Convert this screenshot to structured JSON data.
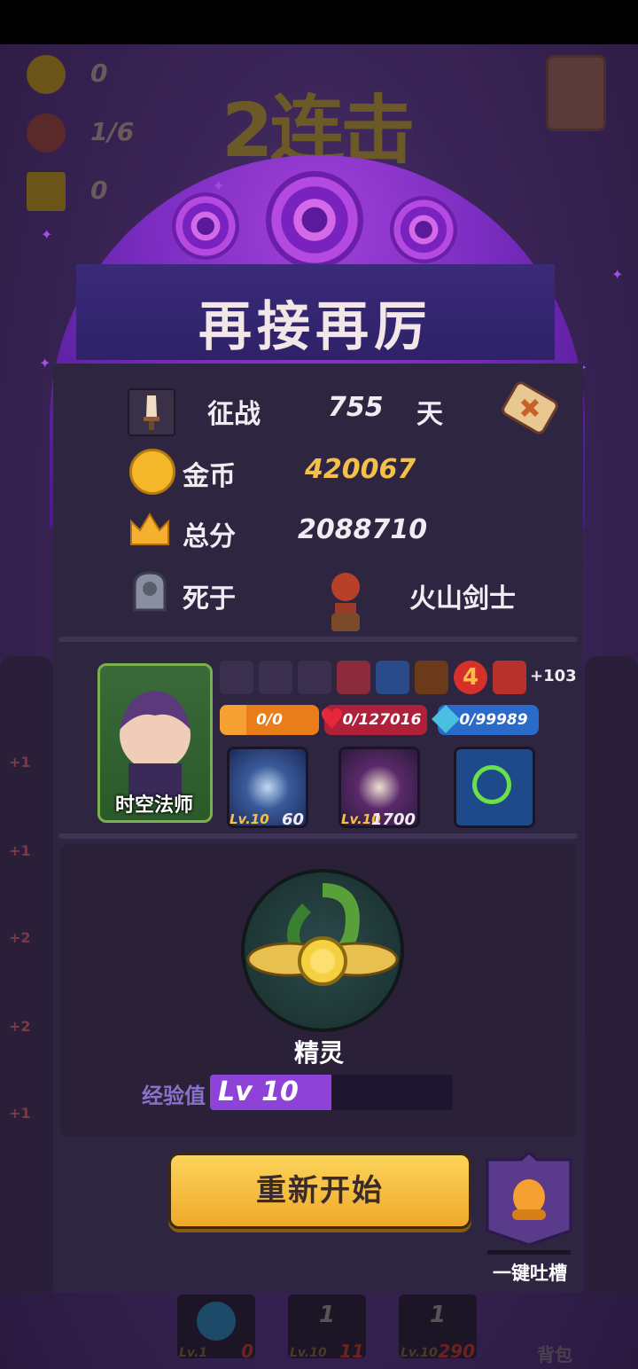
{
  "hud": {
    "coins": "0",
    "kills": "1/6",
    "crowns": "0",
    "combo": "2连击"
  },
  "result": {
    "title": "再接再厉",
    "campaign_label": "征战",
    "campaign_days": "755",
    "campaign_unit": "天",
    "gold_label": "金币",
    "gold_value": "420067",
    "score_label": "总分",
    "score_value": "2088710",
    "death_label": "死于",
    "killer_name": "火山剑士"
  },
  "hero": {
    "name": "时空法师",
    "items_more": "+103",
    "item_badge": "4",
    "shield": "0/0",
    "hp": "0/127016",
    "mana": "0/99989",
    "skills": [
      {
        "level": "Lv.10",
        "value": "60"
      },
      {
        "level": "Lv.10",
        "value": "1700"
      },
      {
        "level": "",
        "value": ""
      }
    ]
  },
  "spirit": {
    "name": "精灵",
    "exp_label": "经验值",
    "level_text": "Lv 10",
    "exp_fraction": 0.5
  },
  "actions": {
    "restart": "重新开始",
    "feedback": "一键吐槽"
  },
  "background": {
    "side_badges": [
      "+1",
      "+1",
      "+2",
      "+2",
      "+1"
    ],
    "slots": [
      {
        "num": "",
        "level": "Lv.1",
        "value": "0"
      },
      {
        "num": "1",
        "level": "Lv.10",
        "value": "11"
      },
      {
        "num": "1",
        "level": "Lv.10",
        "value": "290"
      }
    ],
    "pack": "背包"
  }
}
